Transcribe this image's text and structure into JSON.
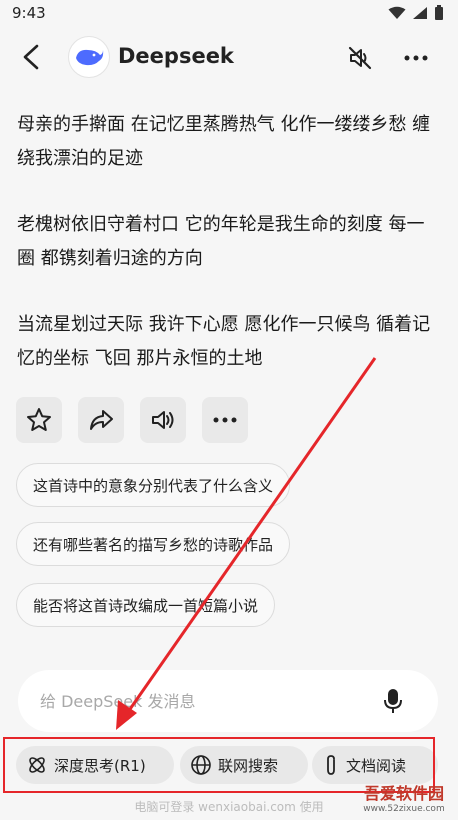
{
  "status_bar": {
    "time": "9:43"
  },
  "header": {
    "title": "Deepseek"
  },
  "messages": [
    "母亲的手擀面 在记忆里蒸腾热气 化作一缕缕乡愁 缠绕我漂泊的足迹",
    "老槐树依旧守着村口 它的年轮是我生命的刻度 每一圈 都镌刻着归途的方向",
    "当流星划过天际 我许下心愿 愿化作一只候鸟 循着记忆的坐标 飞回 那片永恒的土地"
  ],
  "suggestions": [
    "这首诗中的意象分别代表了什么含义",
    "还有哪些著名的描写乡愁的诗歌作品",
    "能否将这首诗改编成一首短篇小说"
  ],
  "input": {
    "placeholder": "给 DeepSeek 发消息"
  },
  "toolbar": {
    "deep_think": "深度思考(R1)",
    "web_search": "联网搜索",
    "doc_read": "文档阅读"
  },
  "footer_note": "电脑可登录 wenxiaobai.com 使用",
  "watermark": {
    "brand": "吾爱软件园",
    "url": "www.52zixue.com"
  },
  "colors": {
    "highlight": "#e5262a",
    "logo_blue": "#4d6bfe"
  }
}
